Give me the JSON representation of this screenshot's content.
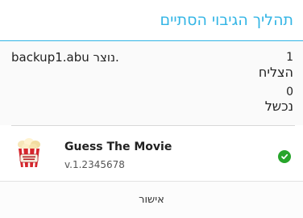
{
  "dialog": {
    "title": "תהליך הגיבוי הסתיים",
    "file_message": "backup1.abu נוצר.",
    "stats": {
      "succeeded_count": "1",
      "succeeded_label": "הצליח",
      "failed_count": "0",
      "failed_label": "נכשל"
    },
    "apps": [
      {
        "name": "Guess The Movie",
        "version": "v.1.2345678",
        "status": "success"
      }
    ],
    "ok_label": "אישור"
  },
  "colors": {
    "accent": "#33b5e5",
    "success": "#27a52b"
  },
  "icons": {
    "app_icon": "popcorn-movie-icon",
    "status_icon": "check-circle-icon"
  }
}
